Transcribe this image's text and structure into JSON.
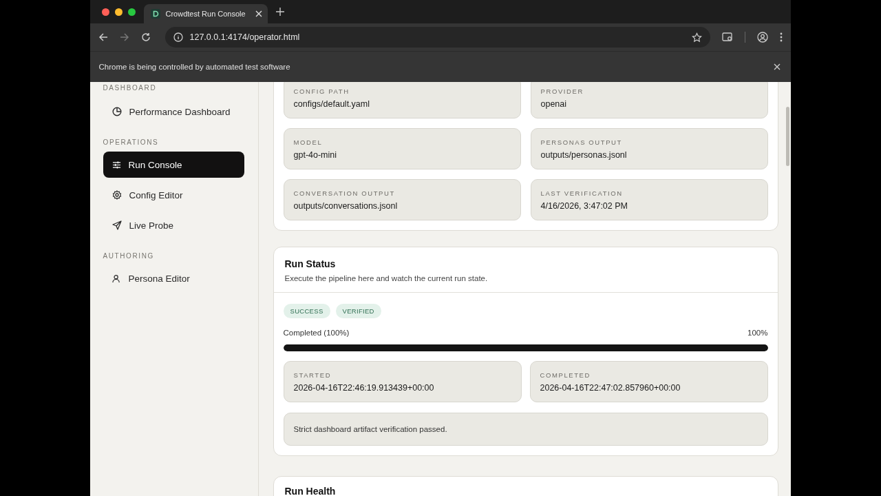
{
  "browser": {
    "tab_title": "Crowdtest Run Console",
    "url": "127.0.0.1:4174/operator.html",
    "infobar": "Chrome is being controlled by automated test software"
  },
  "sidebar": {
    "sections": [
      {
        "label": "DASHBOARD",
        "items": [
          {
            "label": "Performance Dashboard",
            "kind": "chart",
            "selected": false
          }
        ]
      },
      {
        "label": "OPERATIONS",
        "items": [
          {
            "label": "Run Console",
            "kind": "sliders",
            "selected": true
          },
          {
            "label": "Config Editor",
            "kind": "gear",
            "selected": false
          },
          {
            "label": "Live Probe",
            "kind": "send",
            "selected": false
          }
        ]
      },
      {
        "label": "AUTHORING",
        "items": [
          {
            "label": "Persona Editor",
            "kind": "person",
            "selected": false
          }
        ]
      }
    ]
  },
  "config_card": {
    "fields": [
      {
        "label": "CONFIG PATH",
        "value": "configs/default.yaml"
      },
      {
        "label": "PROVIDER",
        "value": "openai"
      },
      {
        "label": "MODEL",
        "value": "gpt-4o-mini"
      },
      {
        "label": "PERSONAS OUTPUT",
        "value": "outputs/personas.jsonl"
      },
      {
        "label": "CONVERSATION OUTPUT",
        "value": "outputs/conversations.jsonl"
      },
      {
        "label": "LAST VERIFICATION",
        "value": "4/16/2026, 3:47:02 PM"
      }
    ]
  },
  "run_status": {
    "title": "Run Status",
    "subtitle": "Execute the pipeline here and watch the current run state.",
    "badges": [
      "SUCCESS",
      "VERIFIED"
    ],
    "progress": {
      "label": "Completed (100%)",
      "reading": "100%",
      "level": 1
    },
    "times": [
      {
        "label": "STARTED",
        "value": "2026-04-16T22:46:19.913439+00:00"
      },
      {
        "label": "COMPLETED",
        "value": "2026-04-16T22:47:02.857960+00:00"
      }
    ],
    "message": "Strict dashboard artifact verification passed."
  },
  "run_health": {
    "title": "Run Health"
  }
}
